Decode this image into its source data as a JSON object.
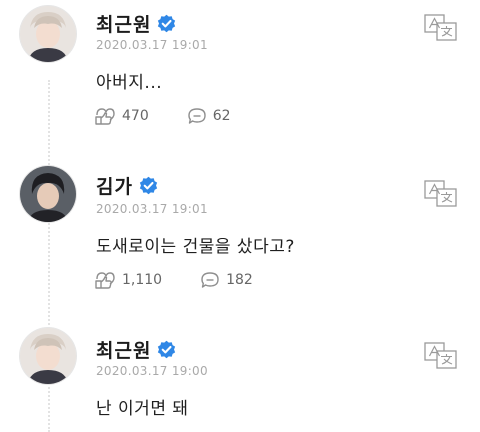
{
  "posts": [
    {
      "author": "최근원",
      "timestamp": "2020.03.17 19:01",
      "message": "아버지...",
      "likes": "470",
      "comments": "62",
      "avatar_icon": "avatar-photo-icon",
      "verified_icon": "verified-badge-icon",
      "translate_icon": "translate-icon"
    },
    {
      "author": "김가",
      "timestamp": "2020.03.17 19:01",
      "message": "도새로이는 건물을 샀다고?",
      "likes": "1,110",
      "comments": "182",
      "avatar_icon": "avatar-photo-icon",
      "verified_icon": "verified-badge-icon",
      "translate_icon": "translate-icon"
    },
    {
      "author": "최근원",
      "timestamp": "2020.03.17 19:00",
      "message": "난 이거면 돼",
      "avatar_icon": "avatar-photo-icon",
      "verified_icon": "verified-badge-icon",
      "translate_icon": "translate-icon"
    }
  ],
  "colors": {
    "verified_blue": "#2f87e6",
    "text_primary": "#1c1c1c",
    "text_muted": "#a9a9a9",
    "icon_gray": "#9a9a9a"
  }
}
